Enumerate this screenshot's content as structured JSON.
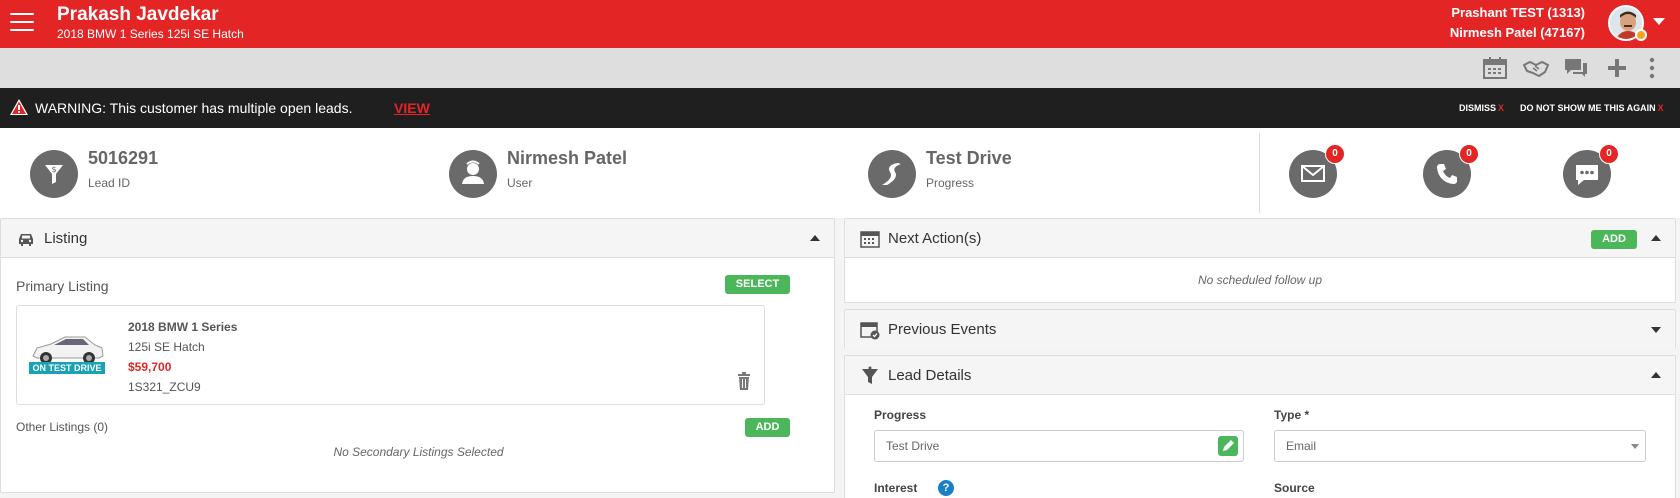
{
  "header": {
    "customer_name": "Prakash Javdekar",
    "vehicle": "2018 BMW 1 Series 125i SE Hatch",
    "user_line1": "Prashant TEST (1313)",
    "user_line2": "Nirmesh Patel (47167)",
    "colors": {
      "brand": "#e42526",
      "status_dot": "#f7a31c"
    }
  },
  "toolbar": {
    "icons": [
      "calendar-icon",
      "handshake-icon",
      "chat-icon",
      "plus-icon",
      "more-vertical-icon"
    ]
  },
  "warning": {
    "text": "WARNING: This customer has multiple open leads.",
    "view_label": "VIEW",
    "dismiss_label": "DISMISS",
    "never_label": "DO NOT SHOW ME THIS AGAIN",
    "x": "X"
  },
  "summary": {
    "lead_id": {
      "value": "5016291",
      "label": "Lead ID"
    },
    "user": {
      "value": "Nirmesh Patel",
      "label": "User"
    },
    "progress": {
      "value": "Test Drive",
      "label": "Progress"
    },
    "email_count": "0",
    "call_count": "0",
    "sms_count": "0"
  },
  "listing": {
    "title": "Listing",
    "primary_title": "Primary Listing",
    "select_label": "SELECT",
    "car": {
      "name": "2018 BMW 1 Series",
      "trim": "125i SE Hatch",
      "price": "$59,700",
      "stock": "1S321_ZCU9",
      "badge": "ON TEST DRIVE"
    },
    "other_title": "Other Listings (0)",
    "add_label": "ADD",
    "no_secondary": "No Secondary Listings Selected"
  },
  "next_actions": {
    "title": "Next Action(s)",
    "add_label": "ADD",
    "empty": "No scheduled follow up"
  },
  "previous_events": {
    "title": "Previous Events"
  },
  "lead_details": {
    "title": "Lead Details",
    "progress_label": "Progress",
    "progress_value": "Test Drive",
    "type_label": "Type *",
    "type_value": "Email",
    "interest_label": "Interest",
    "help_glyph": "?",
    "source_label": "Source"
  }
}
